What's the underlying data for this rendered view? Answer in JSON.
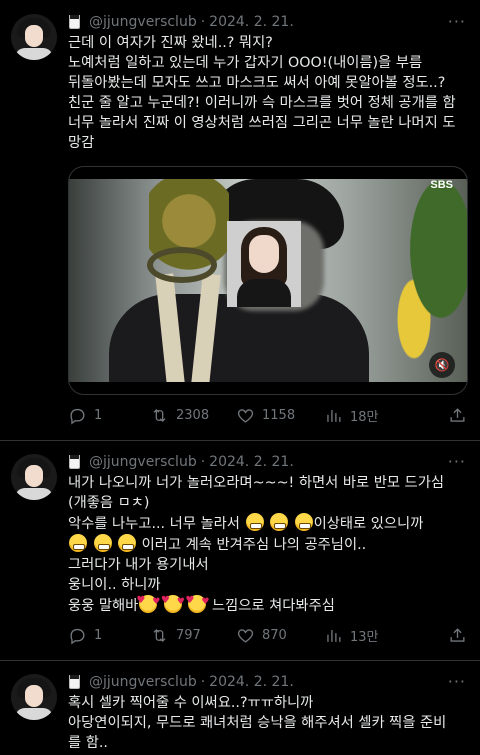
{
  "tweets": [
    {
      "handle": "@jjungversclub",
      "sep": "·",
      "date": "2024. 2. 21.",
      "text": "근데 이 여자가 진짜 왔네..? 뭐지?\n노예처럼 일하고 있는데 누가 갑자기 OOO!(내이름)을 부름\n뒤돌아봤는데 모자도 쓰고 마스크도 써서 아예 못알아볼 정도..?\n친군 줄 알고 누군데?! 이러니까 슥 마스크를 벗어 정체 공개를 함\n너무 놀라서 진짜 이 영상처럼 쓰러짐 그리곤 너무 놀란 나머지 도\n망감",
      "media": {
        "watermark": "SBS",
        "mute_icon": "mute-icon"
      },
      "replies": "1",
      "retweets": "2308",
      "likes": "1158",
      "views": "18만"
    },
    {
      "handle": "@jjungversclub",
      "sep": "·",
      "date": "2024. 2. 21.",
      "lines": [
        "내가 나오니까 너가 놀러오라며~~~! 하면서 바로 반모 드가심",
        "(개좋음 ㅁㅊ)",
        "악수를 나누고... 너무 놀라서",
        "이상태로 있으니까",
        "이러고 계속 반겨주심 나의 공주님이..",
        "그러다가 내가 용기내서",
        "웅니이.. 하니까",
        "웅웅 말해바",
        "느낌으로 쳐다봐주심"
      ],
      "emojis": {
        "grimace": "grimacing-face-emoji",
        "hearts": "smiling-face-with-hearts-emoji"
      },
      "replies": "1",
      "retweets": "797",
      "likes": "870",
      "views": "13만"
    },
    {
      "handle": "@jjungversclub",
      "sep": "·",
      "date": "2024. 2. 21.",
      "text": "혹시 셀카 찍어줄 수 이써요..?ㅠㅠ하니까\n아당연이되지, 무드로 쾌녀처럼 승낙을 해주셔서 셀카 찍을 준비\n를 함.."
    }
  ],
  "more_label": "···",
  "mute_symbol": "🔇"
}
